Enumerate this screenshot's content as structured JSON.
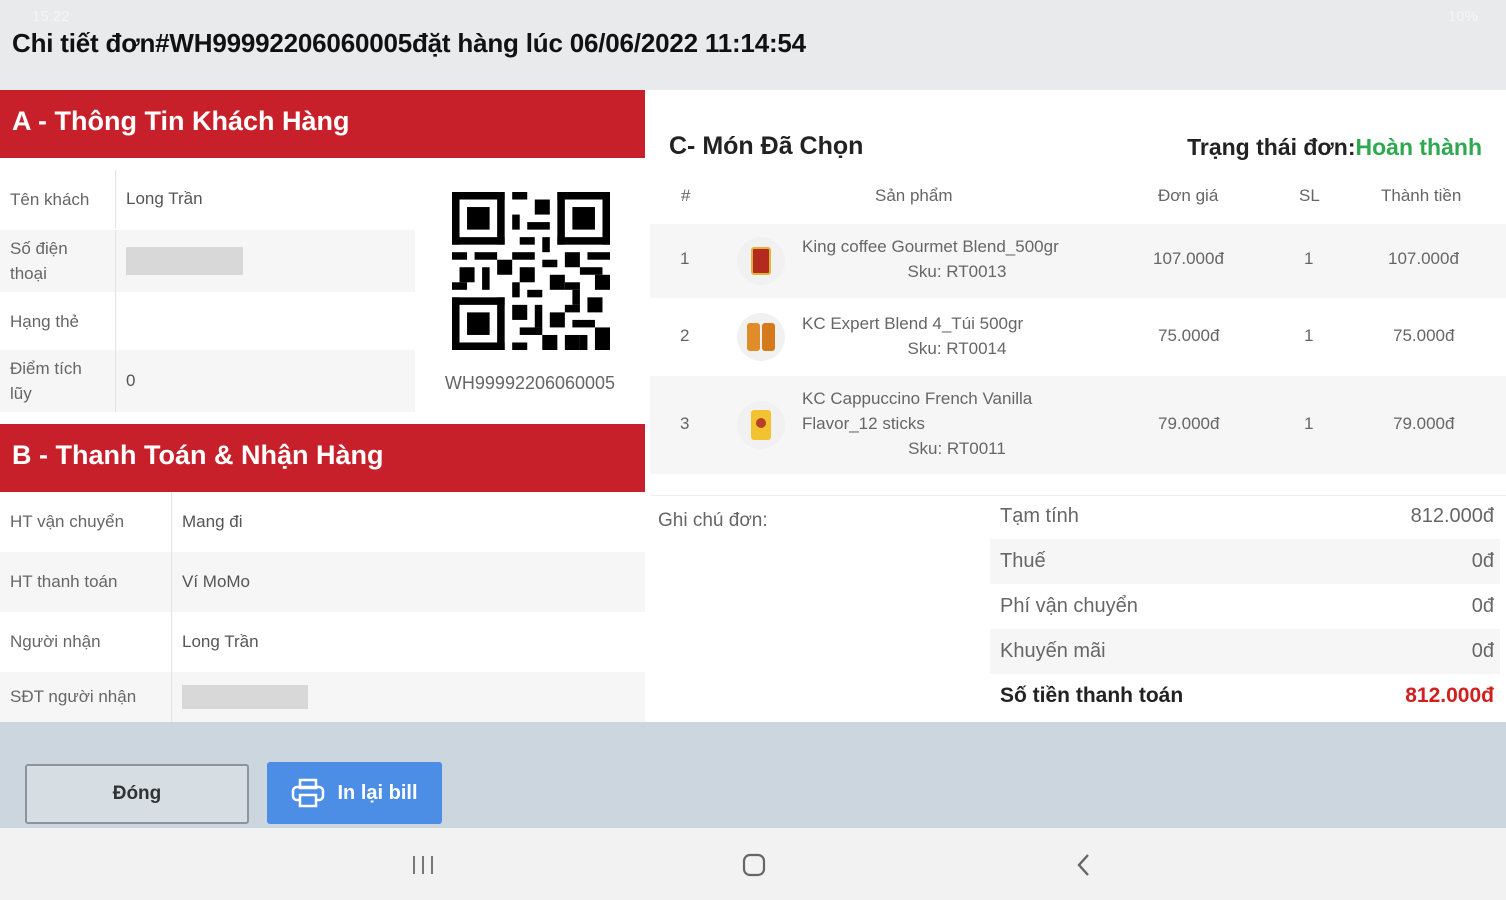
{
  "status_bar": {
    "time": "15:22",
    "right": "10%"
  },
  "header": {
    "title": "Chi tiết đơn#WH99992206060005đặt hàng lúc 06/06/2022 11:14:54"
  },
  "customer": {
    "heading": "A - Thông Tin Khách Hàng",
    "rows": [
      {
        "label": "Tên khách",
        "value": "Long Trần"
      },
      {
        "label": "Số điện thoại",
        "value": ""
      },
      {
        "label": "Hạng thẻ",
        "value": ""
      },
      {
        "label": "Điểm tích lũy",
        "value": "0"
      }
    ],
    "qr_code_text": "WH99992206060005"
  },
  "payment": {
    "heading": "B - Thanh Toán & Nhận Hàng",
    "rows": [
      {
        "label": "HT vận chuyển",
        "value": "Mang đi"
      },
      {
        "label": "HT thanh toán",
        "value": "Ví MoMo"
      },
      {
        "label": "Người nhận",
        "value": "Long Trần"
      },
      {
        "label": "SĐT người nhận",
        "value": ""
      }
    ]
  },
  "order": {
    "heading": "C- Món Đã Chọn",
    "status_label": "Trạng thái đơn:",
    "status_value": "Hoàn thành",
    "status_color": "#2fa84f",
    "columns": [
      "#",
      "Sản phẩm",
      "Đơn giá",
      "SL",
      "Thành tiền"
    ],
    "items": [
      {
        "no": "1",
        "name": "King coffee Gourmet Blend_500gr",
        "sku": "Sku: RT0013",
        "price": "107.000đ",
        "qty": "1",
        "total": "107.000đ"
      },
      {
        "no": "2",
        "name": "KC Expert Blend 4_Túi 500gr",
        "sku": "Sku: RT0014",
        "price": "75.000đ",
        "qty": "1",
        "total": "75.000đ"
      },
      {
        "no": "3",
        "name": "KC Cappuccino French Vanilla Flavor_12 sticks",
        "sku": "Sku: RT0011",
        "price": "79.000đ",
        "qty": "1",
        "total": "79.000đ"
      }
    ],
    "note_label": "Ghi chú đơn:",
    "summary": [
      {
        "label": "Tạm tính",
        "value": "812.000đ"
      },
      {
        "label": "Thuế",
        "value": "0đ"
      },
      {
        "label": "Phí vận chuyển",
        "value": "0đ"
      },
      {
        "label": "Khuyến mãi",
        "value": "0đ"
      }
    ],
    "total_label": "Số tiền thanh toán",
    "total_value": "812.000đ"
  },
  "actions": {
    "close_label": "Đóng",
    "print_label": "In lại bill"
  },
  "colors": {
    "brand_red": "#c8202a",
    "print_blue": "#4c8de6",
    "total_red": "#d0201f"
  }
}
